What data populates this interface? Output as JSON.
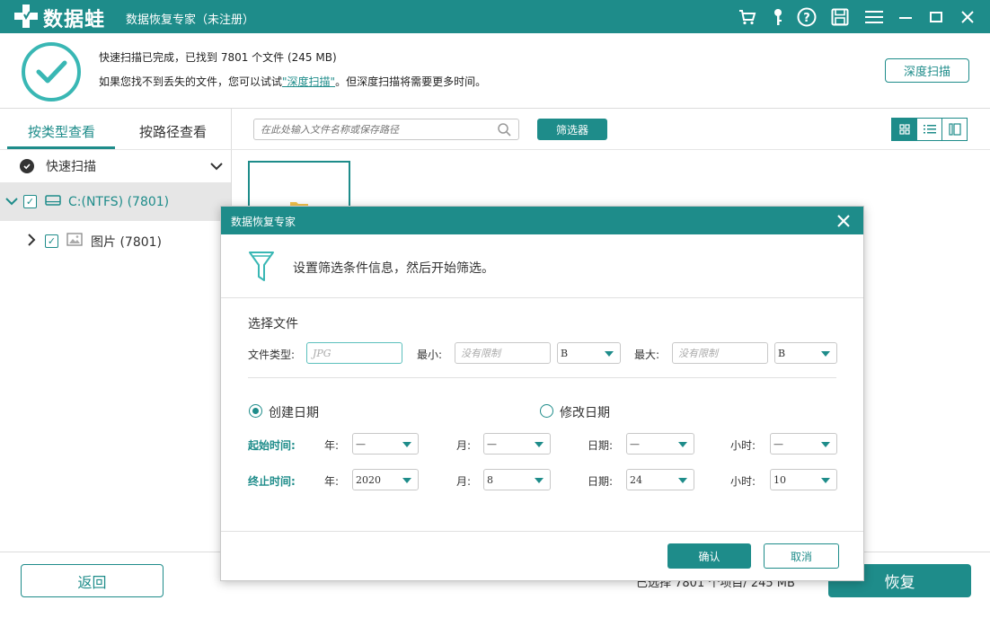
{
  "app": {
    "logo_text": "数据蛙",
    "window_title": "数据恢复专家（未注册）"
  },
  "titlebar_icons": [
    "cart-icon",
    "key-icon",
    "help-icon",
    "save-icon",
    "menu-icon",
    "minimize-icon",
    "maximize-icon",
    "close-icon"
  ],
  "scan_status": {
    "line1": "快速扫描已完成，已找到 7801 个文件 (245 MB)",
    "line2_prefix": "如果您找不到丢失的文件，您可以试试",
    "line2_link": "\"深度扫描\"",
    "line2_suffix": "。但深度扫描将需要更多时间。",
    "deep_scan_button": "深度扫描"
  },
  "left_panel": {
    "tabs": [
      {
        "label": "按类型查看",
        "active": true
      },
      {
        "label": "按路径查看",
        "active": false
      }
    ],
    "quick_scan_label": "快速扫描",
    "tree": [
      {
        "label": "C:(NTFS) (7801)"
      },
      {
        "label": "图片 (7801)"
      }
    ]
  },
  "toolbar": {
    "search_placeholder": "在此处输入文件名称或保存路径",
    "filter_button": "筛选器"
  },
  "bottom": {
    "back_button": "返回",
    "selected_text": "已选择 7801 个项目/ 245 MB",
    "recover_button": "恢复"
  },
  "dialog": {
    "title": "数据恢复专家",
    "description": "设置筛选条件信息，然后开始筛选。",
    "section_title": "选择文件",
    "file_type_label": "文件类型:",
    "file_type_placeholder": "JPG",
    "min_label": "最小:",
    "min_placeholder": "没有限制",
    "min_unit": "B",
    "max_label": "最大:",
    "max_placeholder": "没有限制",
    "max_unit": "B",
    "radio_created": "创建日期",
    "radio_modified": "修改日期",
    "selected_radio": "created",
    "start_time_label": "起始时间:",
    "end_time_label": "终止时间:",
    "year_label": "年:",
    "month_label": "月:",
    "day_label": "日期:",
    "hour_label": "小时:",
    "start": {
      "year": "—",
      "month": "—",
      "day": "—",
      "hour": "—"
    },
    "end": {
      "year": "2020",
      "month": "8",
      "day": "24",
      "hour": "10"
    },
    "ok_button": "确认",
    "cancel_button": "取消"
  },
  "colors": {
    "accent": "#1e8c8a",
    "accent_light": "#39b7b4"
  }
}
